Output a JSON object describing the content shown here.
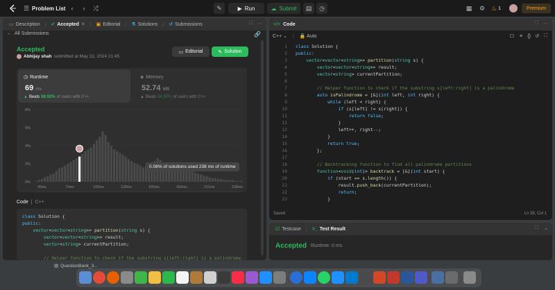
{
  "topbar": {
    "title": "Problem List",
    "run_label": "Run",
    "submit_label": "Submit",
    "streak": "1",
    "premium_label": "Premium"
  },
  "left_panel": {
    "tabs": [
      {
        "label": "Description"
      },
      {
        "label": "Accepted"
      },
      {
        "label": "Editorial"
      },
      {
        "label": "Solutions"
      },
      {
        "label": "Submissions"
      }
    ],
    "back_label": "All Submissions",
    "status": "Accepted",
    "user": "Abhijay shah",
    "submitted_text": "submitted at May 22, 2024 21:45",
    "editorial_btn": "Editorial",
    "solution_btn": "Solution",
    "runtime": {
      "label": "Runtime",
      "value": "69",
      "unit": "ms",
      "beats_prefix": "Beats",
      "beats_pct": "88.92%",
      "beats_suffix": "of users with C++"
    },
    "memory": {
      "label": "Memory",
      "value": "52.74",
      "unit": "MB",
      "beats_prefix": "Beats",
      "beats_pct": "84.90%",
      "beats_suffix": "of users with C++"
    },
    "tooltip": "0.08% of solutions used 238 ms of runtime",
    "code_label": "Code",
    "code_lang": "C++",
    "code_lines": [
      "class Solution {",
      "public:",
      "    vector<vector<string>> partition(string s) {",
      "        vector<vector<string>> result;",
      "        vector<string> currentPartition;",
      "",
      "        // Helper function to check if the substring s[left:right] is a palindrome"
    ]
  },
  "chart_data": {
    "type": "bar",
    "title": "",
    "xlabel": "",
    "ylabel": "",
    "y_ticks": [
      "8%",
      "6%",
      "4%",
      "2%",
      "0%"
    ],
    "ylim": [
      0,
      8
    ],
    "x_ticks": [
      "45ms",
      "73ms",
      "100ms",
      "128ms",
      "155ms",
      "183ms",
      "211ms",
      "238ms"
    ],
    "mini_x_ticks": [
      "45ms",
      "73ms",
      "100ms",
      "128ms",
      "155ms",
      "183ms",
      "211ms",
      "238ms"
    ],
    "values": [
      0.1,
      0.2,
      0.3,
      0.5,
      0.6,
      0.8,
      0.9,
      1.2,
      1.5,
      1.6,
      1.8,
      2.0,
      2.2,
      2.4,
      2.6,
      2.8,
      3.1,
      3.4,
      3.6,
      3.8,
      4.2,
      4.6,
      5.0,
      5.6,
      5.2,
      4.4,
      4.0,
      3.6,
      3.4,
      3.2,
      3.0,
      2.8,
      2.5,
      2.3,
      2.1,
      2.0,
      1.8,
      1.6,
      1.7,
      1.9,
      2.1,
      2.3,
      2.6,
      2.4,
      2.1,
      1.8,
      1.5,
      1.3,
      1.4,
      1.6,
      1.9,
      2.1,
      1.8,
      1.5,
      1.2,
      1.0,
      0.9,
      0.8,
      0.7,
      0.6,
      0.5,
      0.4,
      0.4,
      0.3,
      0.3,
      0.2,
      0.2,
      0.2,
      0.2,
      0.1,
      0.1,
      0.1
    ],
    "highlight_index": 15,
    "highlight_value": 2.6
  },
  "editor": {
    "title": "Code",
    "lang": "C++",
    "mode": "Auto",
    "saved": "Saved",
    "cursor": "Ln 38, Col 1",
    "lines": [
      {
        "n": "1",
        "t": "class Solution {"
      },
      {
        "n": "2",
        "t": "public:"
      },
      {
        "n": "3",
        "t": "    vector<vector<string>> partition(string s) {"
      },
      {
        "n": "4",
        "t": "        vector<vector<string>> result;"
      },
      {
        "n": "5",
        "t": "        vector<string> currentPartition;"
      },
      {
        "n": "6",
        "t": ""
      },
      {
        "n": "7",
        "t": "        // Helper function to check if the substring s[left:right] is a palindrome"
      },
      {
        "n": "8",
        "t": "        auto isPalindrome = [&](int left, int right) {"
      },
      {
        "n": "9",
        "t": "            while (left < right) {"
      },
      {
        "n": "10",
        "t": "                if (s[left] != s[right]) {"
      },
      {
        "n": "11",
        "t": "                    return false;"
      },
      {
        "n": "12",
        "t": "                }"
      },
      {
        "n": "13",
        "t": "                left++, right--;"
      },
      {
        "n": "14",
        "t": "            }"
      },
      {
        "n": "15",
        "t": "            return true;"
      },
      {
        "n": "16",
        "t": "        };"
      },
      {
        "n": "17",
        "t": ""
      },
      {
        "n": "18",
        "t": "        // Backtracking function to find all palindrome partitions"
      },
      {
        "n": "19",
        "t": "        function<void(int)> backtrack = [&](int start) {"
      },
      {
        "n": "20",
        "t": "            if (start == s.length()) {"
      },
      {
        "n": "21",
        "t": "                result.push_back(currentPartition);"
      },
      {
        "n": "22",
        "t": "                return;"
      },
      {
        "n": "23",
        "t": "            }"
      }
    ]
  },
  "testpanel": {
    "tab1": "Testcase",
    "tab2": "Test Result",
    "status": "Accepted",
    "runtime": "Runtime: 0 ms"
  },
  "taskbar": {
    "item": "QuestionBank_3..."
  },
  "colors": {
    "accent_green": "#2cbb5d",
    "premium_orange": "#ffa116",
    "bg": "#1a1a1a",
    "panel": "#262626"
  }
}
